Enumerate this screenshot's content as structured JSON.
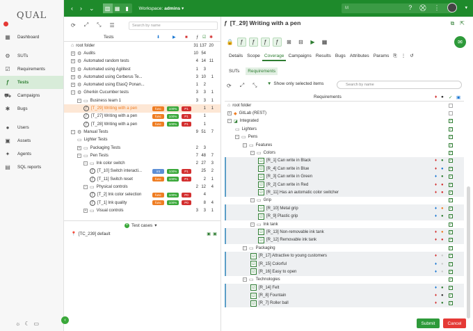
{
  "app": {
    "logo": "QUAL"
  },
  "nav": [
    {
      "label": "Dashboard",
      "icon": "dashboard-icon"
    },
    {
      "label": "SUTs",
      "icon": "sut-icon"
    },
    {
      "label": "Requirements",
      "icon": "requirements-icon"
    },
    {
      "label": "Tests",
      "icon": "tests-icon",
      "active": true
    },
    {
      "label": "Campaigns",
      "icon": "campaigns-icon"
    },
    {
      "label": "Bugs",
      "icon": "bug-icon"
    },
    {
      "label": "Users",
      "icon": "users-icon"
    },
    {
      "label": "Assets",
      "icon": "assets-icon"
    },
    {
      "label": "Agents",
      "icon": "agents-icon"
    },
    {
      "label": "SQL reports",
      "icon": "report-icon"
    }
  ],
  "topbar": {
    "workspace_label": "Workspace:",
    "workspace_value": "admins",
    "search_value": "M"
  },
  "left": {
    "search_placeholder": "Search by name",
    "header": {
      "tests": "Tests"
    },
    "rows": [
      {
        "name": "root folder",
        "n1": "31",
        "n2": "137",
        "n3": "20"
      },
      {
        "name": "Audits",
        "n1": "10",
        "n2": "54",
        "n3": ""
      },
      {
        "name": "Automated random tests",
        "n1": "4",
        "n2": "14",
        "n3": "11"
      },
      {
        "name": "Automated using Agilitest",
        "n1": "1",
        "n2": "3",
        "n3": ""
      },
      {
        "name": "Automated using Cerberus Te...",
        "n1": "3",
        "n2": "10",
        "n3": "1"
      },
      {
        "name": "Automated using EtasQ Ponan...",
        "n1": "1",
        "n2": "2",
        "n3": ""
      },
      {
        "name": "Gherkin Cucumber tests",
        "n1": "3",
        "n2": "3",
        "n3": "1"
      },
      {
        "name": "Business team 1",
        "n1": "3",
        "n2": "3",
        "n3": "1"
      },
      {
        "name": "[T_29] Writing with a pen",
        "n1": "",
        "n2": "1",
        "n3": "1",
        "tag1": "func",
        "pct": "100%",
        "tag3": "P1"
      },
      {
        "name": "[T_27] Writing with a pen",
        "n1": "",
        "n2": "1",
        "n3": "",
        "tag1": "func",
        "pct": "100%",
        "tag3": "P1"
      },
      {
        "name": "[T_28] Writing with a pen",
        "n1": "",
        "n2": "1",
        "n3": "",
        "tag1": "func",
        "pct": "100%",
        "tag3": "P1"
      },
      {
        "name": "Manual Tests",
        "n1": "9",
        "n2": "51",
        "n3": "7"
      },
      {
        "name": "Lighter Tests",
        "n1": "",
        "n2": "",
        "n3": ""
      },
      {
        "name": "Packaging Tests",
        "n1": "2",
        "n2": "3",
        "n3": ""
      },
      {
        "name": "Pen Tests",
        "n1": "7",
        "n2": "48",
        "n3": "7"
      },
      {
        "name": "Ink color switch",
        "n1": "2",
        "n2": "27",
        "n3": "3"
      },
      {
        "name": "[T_10] Switch interacti...",
        "n1": "",
        "n2": "25",
        "n3": "2",
        "tag1": "int",
        "pct": "100%",
        "tag3": "P1"
      },
      {
        "name": "[T_11] Switch reset",
        "n1": "",
        "n2": "2",
        "n3": "1",
        "tag1": "func",
        "pct": "100%",
        "tag3": "P1"
      },
      {
        "name": "Physical controls",
        "n1": "2",
        "n2": "12",
        "n3": "4"
      },
      {
        "name": "[T_2] Ink color selection",
        "n1": "",
        "n2": "4",
        "n3": "",
        "tag1": "func",
        "pct": "100%",
        "tag3": "P0"
      },
      {
        "name": "[T_1] Ink quality",
        "n1": "",
        "n2": "8",
        "n3": "4",
        "tag1": "func",
        "pct": "100%",
        "tag3": "P0"
      },
      {
        "name": "Visual controls",
        "n1": "3",
        "n2": "3",
        "n3": "1"
      }
    ],
    "test_cases_label": "Test cases",
    "test_case_row": "[TC_239] default"
  },
  "right": {
    "title": "[T_29] Writing with a pen",
    "tabs": [
      "Details",
      "Scope",
      "Coverage",
      "Campaigns",
      "Results",
      "Bugs",
      "Attributes",
      "Params"
    ],
    "active_tab": "Coverage",
    "subtabs": [
      "SUTs",
      "Requirements"
    ],
    "only_selected": "Show only selected items",
    "search_placeholder": "Search by name",
    "header": "Requirements",
    "rows": [
      {
        "name": "root folder",
        "type": "root"
      },
      {
        "name": "GitLab (REST)",
        "type": "gitlab"
      },
      {
        "name": "Integrated",
        "type": "integrated"
      },
      {
        "name": "Lighters",
        "type": "folder"
      },
      {
        "name": "Pens",
        "type": "folder"
      },
      {
        "name": "Features",
        "type": "folder"
      },
      {
        "name": "Colors",
        "type": "folder"
      },
      {
        "name": "[R_1] Can write in Black",
        "type": "req"
      },
      {
        "name": "[R_4] Can write in Blue",
        "type": "req"
      },
      {
        "name": "[R_3] Can write in Green",
        "type": "req"
      },
      {
        "name": "[R_2] Can write in Red",
        "type": "req"
      },
      {
        "name": "[R_11] Has an automatic color switcher",
        "type": "req"
      },
      {
        "name": "Grip",
        "type": "folder"
      },
      {
        "name": "[R_10] Metal grip",
        "type": "req"
      },
      {
        "name": "[R_9] Plastic grip",
        "type": "req"
      },
      {
        "name": "Ink tank",
        "type": "folder"
      },
      {
        "name": "[R_13] Non-removable ink tank",
        "type": "req"
      },
      {
        "name": "[R_12] Removable ink tank",
        "type": "req"
      },
      {
        "name": "Packaging",
        "type": "folder"
      },
      {
        "name": "[R_17] Attractive to young customers",
        "type": "req"
      },
      {
        "name": "[R_15] Colorful",
        "type": "req"
      },
      {
        "name": "[R_16] Easy to open",
        "type": "req"
      },
      {
        "name": "Technologies",
        "type": "folder"
      },
      {
        "name": "[R_14] Felt",
        "type": "req"
      },
      {
        "name": "[R_8] Fountain",
        "type": "req"
      },
      {
        "name": "[R_7] Roller ball",
        "type": "req"
      }
    ],
    "submit": "Submit",
    "cancel": "Cancel"
  },
  "colors": {
    "brand": "#1e8a2b",
    "accent": "#2e7d32",
    "func": "#ef7d22",
    "int": "#5c8fd6",
    "pct": "#3aa83a",
    "prio": "#d32f2f"
  }
}
